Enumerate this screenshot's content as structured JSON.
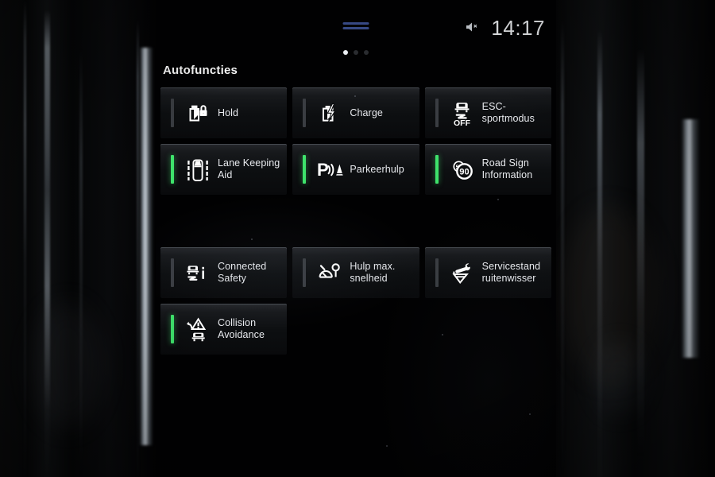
{
  "statusbar": {
    "clock": "14:17",
    "mute_icon": "speaker-mute-icon",
    "drag_handle_icon": "drag-handle-icon",
    "accent_handle_color": "#3b4f8e",
    "page_dots": {
      "total": 3,
      "active_index": 0
    }
  },
  "page": {
    "title": "Autofuncties",
    "active_indicator_color": "#3ee26b",
    "inactive_indicator_color": "#3a3d42",
    "tile_background": "#17191c",
    "text_color": "#e8eaee"
  },
  "tiles": [
    {
      "id": "hold",
      "label": "Hold",
      "icon": "battery-lock-icon",
      "active": false
    },
    {
      "id": "charge",
      "label": "Charge",
      "icon": "battery-charge-icon",
      "active": false
    },
    {
      "id": "esc-sport",
      "label": "ESC-sportmodus",
      "icon": "esc-off-icon",
      "active": false
    },
    {
      "id": "lane-keep",
      "label": "Lane Keeping Aid",
      "icon": "lane-keeping-icon",
      "active": true
    },
    {
      "id": "park-assist",
      "label": "Parkeerhulp",
      "icon": "park-assist-icon",
      "active": true
    },
    {
      "id": "road-sign",
      "label": "Road Sign Information",
      "icon": "road-sign-90-icon",
      "active": true
    },
    {
      "id": "conn-safety",
      "label": "Connected Safety",
      "icon": "connected-safety-icon",
      "active": false
    },
    {
      "id": "max-speed",
      "label": "Hulp max. snelheid",
      "icon": "speed-limiter-icon",
      "active": false
    },
    {
      "id": "wiper-serv",
      "label": "Servicestand ruitenwisser",
      "icon": "wiper-service-icon",
      "active": false
    },
    {
      "id": "collision",
      "label": "Collision Avoidance",
      "icon": "collision-avoidance-icon",
      "active": true
    }
  ],
  "icon_text": {
    "esc_off": "OFF",
    "road_sign_speed": "90"
  }
}
